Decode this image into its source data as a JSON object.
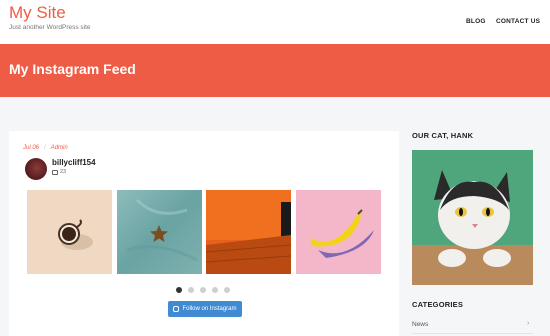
{
  "site": {
    "title": "My Site",
    "tagline": "Just another WordPress site"
  },
  "nav": {
    "items": [
      "BLOG",
      "CONTACT US"
    ]
  },
  "banner": {
    "title": "My Instagram Feed"
  },
  "post": {
    "date": "Jul 06",
    "author": "Admin",
    "feed": {
      "username": "billycliff154",
      "media_count": "23",
      "photos": [
        "coffee-cup-icon",
        "starfish-icon",
        "orange-room-icon",
        "banana-icon"
      ],
      "pagination": {
        "total": 5,
        "active": 1
      },
      "follow_label": "Follow on Instagram"
    }
  },
  "sidebar": {
    "cat_heading": "OUR CAT, HANK",
    "categories_heading": "CATEGORIES",
    "categories": [
      "News"
    ]
  },
  "colors": {
    "accent": "#ef5c45",
    "button": "#408bd1",
    "background": "#f5f6f8"
  }
}
